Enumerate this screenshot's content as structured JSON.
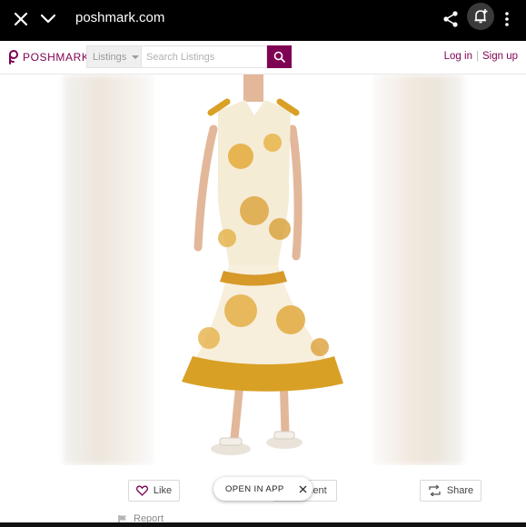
{
  "browser": {
    "url": "poshmark.com",
    "icons": [
      "close-icon",
      "chevron-down-icon",
      "share-icon",
      "notification-add-icon",
      "more-vert-icon"
    ]
  },
  "header": {
    "logo_text": "POSHMARK",
    "category_label": "Listings",
    "search_placeholder": "Search Listings",
    "login_label": "Log in",
    "separator": "|",
    "signup_label": "Sign up",
    "brand_color": "#7f0353"
  },
  "actions": {
    "like_label": "Like",
    "comment_label": "ment",
    "share_label": "Share",
    "open_app_label": "OPEN IN APP",
    "report_label": "Report"
  }
}
